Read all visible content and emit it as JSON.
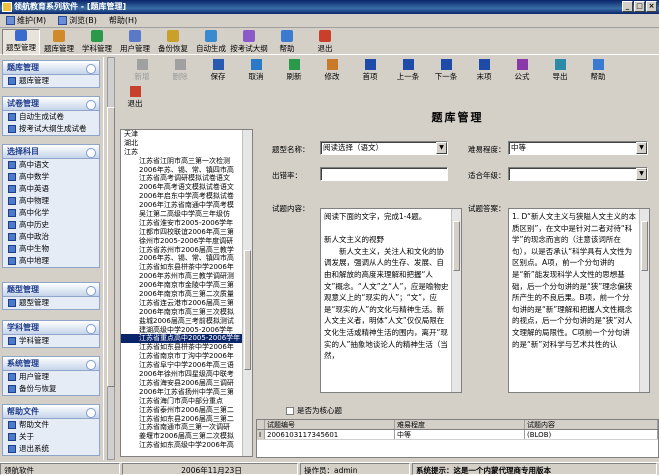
{
  "window": {
    "title": "领航教育系列软件 - [题库管理]"
  },
  "menu": [
    {
      "label": "维护(M)"
    },
    {
      "label": "浏览(B)"
    },
    {
      "label": "帮助(H)"
    }
  ],
  "main_toolbar": [
    {
      "label": "题型管理",
      "icon": "question-type-icon",
      "color": "#3a6ad0",
      "active": true
    },
    {
      "label": "题库管理",
      "icon": "question-bank-icon",
      "color": "#d08a2a"
    },
    {
      "label": "学科管理",
      "icon": "subject-icon",
      "color": "#2a9a4a"
    },
    {
      "label": "用户管理",
      "icon": "users-icon",
      "color": "#5a7ac8"
    },
    {
      "label": "备份恢复",
      "icon": "backup-icon",
      "color": "#c8a02a"
    },
    {
      "label": "自动生成",
      "icon": "auto-generate-icon",
      "color": "#3a8ad0"
    },
    {
      "label": "按考试大纲",
      "icon": "syllabus-icon",
      "color": "#8a5ac8"
    },
    {
      "label": "帮助",
      "icon": "help-icon",
      "color": "#3a7ad0"
    },
    {
      "label": "退出",
      "icon": "exit-icon",
      "color": "#c8402a"
    }
  ],
  "sidebar": {
    "groups": [
      {
        "title": "题库管理",
        "items": [
          {
            "label": "题库管理",
            "icon": "question-bank-icon"
          }
        ]
      },
      {
        "title": "试卷管理",
        "items": [
          {
            "label": "自动生成试卷",
            "icon": "auto-generate-icon"
          },
          {
            "label": "按考试大纲生成试卷",
            "icon": "syllabus-icon"
          }
        ]
      },
      {
        "title": "选择科目",
        "items": [
          {
            "label": "高中语文",
            "icon": "book-icon"
          },
          {
            "label": "高中数学",
            "icon": "book-icon"
          },
          {
            "label": "高中英语",
            "icon": "book-icon"
          },
          {
            "label": "高中物理",
            "icon": "book-icon"
          },
          {
            "label": "高中化学",
            "icon": "book-icon"
          },
          {
            "label": "高中历史",
            "icon": "book-icon"
          },
          {
            "label": "高中政治",
            "icon": "book-icon"
          },
          {
            "label": "高中生物",
            "icon": "book-icon"
          },
          {
            "label": "高中地理",
            "icon": "book-icon"
          }
        ]
      },
      {
        "title": "题型管理",
        "items": [
          {
            "label": "题型管理",
            "icon": "question-type-icon"
          }
        ]
      },
      {
        "title": "学科管理",
        "items": [
          {
            "label": "学科管理",
            "icon": "subject-icon"
          }
        ]
      },
      {
        "title": "系统管理",
        "items": [
          {
            "label": "用户管理",
            "icon": "users-icon"
          },
          {
            "label": "备份与恢复",
            "icon": "backup-icon"
          }
        ]
      },
      {
        "title": "帮助文件",
        "items": [
          {
            "label": "帮助文件",
            "icon": "help-icon"
          },
          {
            "label": "关于",
            "icon": "info-icon"
          },
          {
            "label": "退出系统",
            "icon": "exit-icon"
          }
        ]
      }
    ]
  },
  "sub_toolbar": [
    {
      "label": "新增",
      "icon": "add-icon",
      "enabled": false
    },
    {
      "label": "删除",
      "icon": "delete-icon",
      "enabled": false
    },
    {
      "label": "保存",
      "icon": "save-icon",
      "enabled": true
    },
    {
      "label": "取消",
      "icon": "cancel-icon",
      "enabled": true
    },
    {
      "label": "刷新",
      "icon": "refresh-icon",
      "enabled": true
    },
    {
      "label": "修改",
      "icon": "edit-icon",
      "enabled": true
    },
    {
      "label": "首项",
      "icon": "first-icon",
      "enabled": true
    },
    {
      "label": "上一条",
      "icon": "previous-icon",
      "enabled": true
    },
    {
      "label": "下一条",
      "icon": "next-icon",
      "enabled": true
    },
    {
      "label": "末项",
      "icon": "last-icon",
      "enabled": true
    },
    {
      "label": "公式",
      "icon": "formula-icon",
      "enabled": true
    },
    {
      "label": "导出",
      "icon": "export-icon",
      "enabled": true
    },
    {
      "label": "帮助",
      "icon": "help-icon",
      "enabled": true
    },
    {
      "label": "退出",
      "icon": "exit-icon",
      "enabled": true
    }
  ],
  "tree": {
    "nodes": [
      {
        "label": "天津",
        "level": 0
      },
      {
        "label": "湖北",
        "level": 0
      },
      {
        "label": "江苏",
        "level": 0
      },
      {
        "label": "江苏省江阴市高三第一次检测",
        "level": 1
      },
      {
        "label": "2006年苏、锡、常、镇四市高",
        "level": 1
      },
      {
        "label": "江苏省高考调研模拟试卷语文",
        "level": 1
      },
      {
        "label": "2006年高考语文模拟试卷语文",
        "level": 1
      },
      {
        "label": "2006年启东中学高考模拟试卷",
        "level": 1
      },
      {
        "label": "2006年江苏省南通中学高考模",
        "level": 1
      },
      {
        "label": "吴江第二高级中学高三年级仿",
        "level": 1
      },
      {
        "label": "江苏省淮安市2005-2006学年",
        "level": 1
      },
      {
        "label": "江都市四校联谊2006年高三第",
        "level": 1
      },
      {
        "label": "徐州市2005-2006学年度调研",
        "level": 1
      },
      {
        "label": "江苏省苏州市2006届高三教学",
        "level": 1
      },
      {
        "label": "2006年苏、锡、常、镇四市高",
        "level": 1
      },
      {
        "label": "江苏省如东县栟茶中学2006年",
        "level": 1
      },
      {
        "label": "2006年苏州市高三教学调研测",
        "level": 1
      },
      {
        "label": "2006年南京市金陵中学高三第",
        "level": 1
      },
      {
        "label": "2006年南京市高三第二次质量",
        "level": 1
      },
      {
        "label": "江苏省连云港市2006届高三第",
        "level": 1
      },
      {
        "label": "2006年南京市高三第三次模拟",
        "level": 1
      },
      {
        "label": "盐城2006届高三考前模拟测试",
        "level": 1
      },
      {
        "label": "建湖高级中学2005-2006学年",
        "level": 1
      },
      {
        "label": "江苏省重点高中2005-2006学年",
        "level": 1,
        "selected": true
      },
      {
        "label": "江苏省如东县栟茶中学2006年",
        "level": 1
      },
      {
        "label": "江苏省南京市丁沟中学2006年",
        "level": 1
      },
      {
        "label": "江苏省阜宁中学2006年高三语",
        "level": 1
      },
      {
        "label": "2006年徐州市四星级高中联考",
        "level": 1
      },
      {
        "label": "江苏省海安县2006届高三调研",
        "level": 1
      },
      {
        "label": "2006年江苏省扬州中学高三第",
        "level": 1
      },
      {
        "label": "江苏省海门市高中部分重点",
        "level": 1
      },
      {
        "label": "江苏省泰州市2006届高三第二",
        "level": 1
      },
      {
        "label": "江苏省如东县2006届高三第二",
        "level": 1
      },
      {
        "label": "江苏省南通市高三第一次调研",
        "level": 1
      },
      {
        "label": "姜堰市2006届高三第二次模拟",
        "level": 1
      },
      {
        "label": "江苏省如东高级中学2006年高",
        "level": 1
      }
    ]
  },
  "form": {
    "title": "题库管理",
    "question_type_label": "题型名称：",
    "question_type_value": "阅读选择（语文）",
    "difficulty_label": "难易程度：",
    "difficulty_value": "中等",
    "author_label": "出错率：",
    "author_value": "",
    "grade_label": "适合年级：",
    "grade_value": "",
    "content_label": "试题内容：",
    "content_value": "阅读下面的文字，完成1-4题。\n\n新人文主义的视野\n　　新人文主义，关注人和文化的协调发展，强调从人的生存、发展、自由和解放的高度来理解和把握“人文”概念。“人文”之“人”，应是喻物史观意义上的“现实的人”；“文”，应是“现实的人”的文化与精神生活。新人文主义者，明体“人文”仅仅局限在文化生活或精神生活的围内，离开“现实的人”抽象地谈论人的精神生活（当然，",
    "answer_label": "试题答案：",
    "answer_value": "1. D“新人文主义与狭隘人文主义的本质区别”，在文中是针对二者对待“科学”的现念而言的（注意该词所在句），以是否承认“科学具有人文性为区别点。A项，前一个分句讲的是“新”能发现科学人文性的思想基础，后一个分句讲的是“狭”理念偏狭所产生的不良后果。B项，前一个分句讲的是“新”理解和把握人文性概念的视点，后一个分句讲的是“狭”对人文理解的局限性。C项前一个分句讲的是“新”对科学与艺术共性的认",
    "core_question_label": "是否为核心题"
  },
  "grid": {
    "headers": [
      "试题编号",
      "难易程度",
      "试题内容"
    ],
    "rows": [
      [
        "20061031173456​01",
        "中等",
        "(BLOB)"
      ]
    ]
  },
  "status": {
    "app": "领航软件",
    "date": "2006年11月23日",
    "operator": "操作员：admin",
    "system_tip": "系统提示：这是一个内蒙代理商专用版本"
  }
}
